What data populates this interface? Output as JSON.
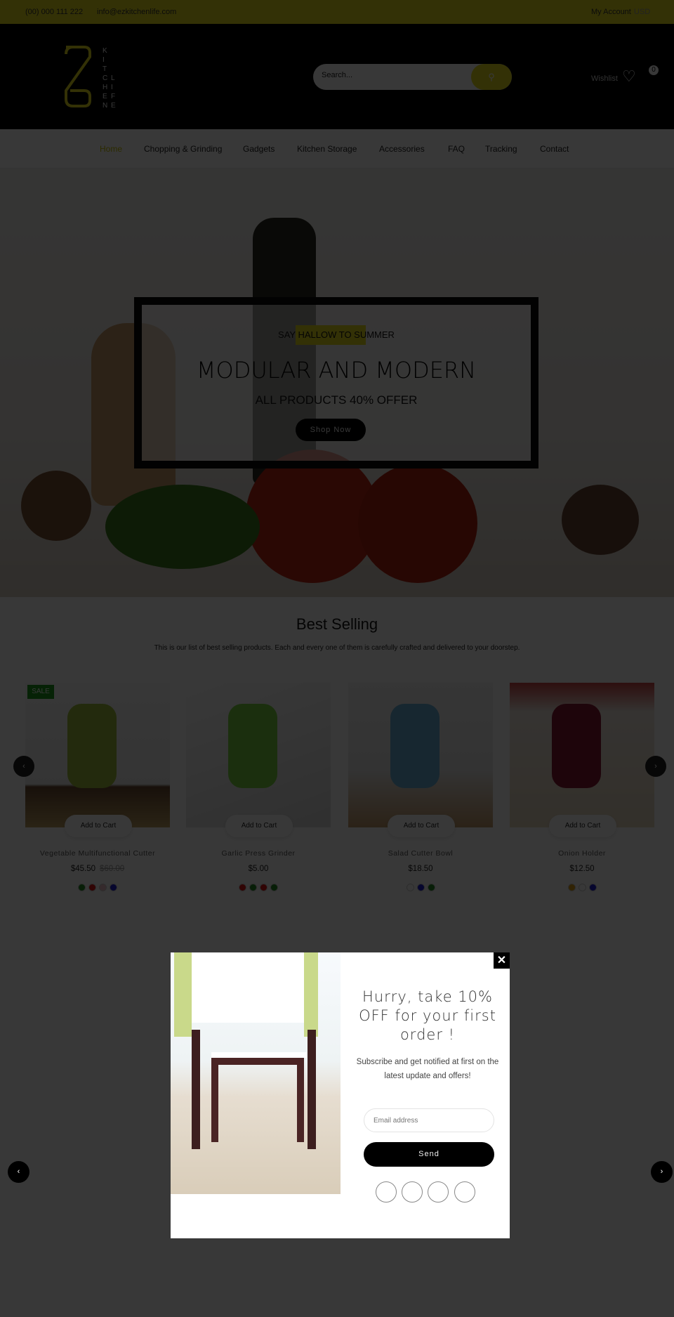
{
  "topbar": {
    "phone": "(00) 000 111 222",
    "email": "info@ezkitchenlife.com",
    "account": "My Account",
    "currency": "USD",
    "accent": "#e6e019"
  },
  "header": {
    "logo_text": "KITCHEN LIFE",
    "search_placeholder": "Search...",
    "search_icon": "search-icon",
    "wishlist": "Wishlist",
    "wishlist_count": "0"
  },
  "nav": [
    "Home",
    "Chopping & Grinding",
    "Gadgets",
    "Kitchen Storage",
    "Accessories",
    "FAQ",
    "Tracking",
    "Contact"
  ],
  "hero": {
    "kicker": "SAY HALLOW TO SUMMER",
    "title": "MODULAR AND MODERN",
    "subtitle": "ALL PRODUCTS 40% OFFER",
    "cta": "Shop Now"
  },
  "best": {
    "title": "Best Selling",
    "subtitle": "This is our list of best selling products. Each and every one of them is carefully crafted and delivered to your doorstep.",
    "products": [
      {
        "name": "Vegetable Multifunctional Cutter",
        "price": "$45.50",
        "old_price": "$60.00",
        "badge": "SALE",
        "add": "Add to Cart",
        "colors": [
          "#1f8a1f",
          "#d11",
          "#f0c0c8",
          "#1a1ad0"
        ]
      },
      {
        "name": "Garlic Press Grinder",
        "price": "$5.00",
        "add": "Add to Cart",
        "colors": [
          "#d11",
          "#1f8a1f",
          "#d11",
          "#1f8a1f"
        ]
      },
      {
        "name": "Salad Cutter Bowl",
        "price": "$18.50",
        "add": "Add to Cart",
        "colors": [
          "#ffffff",
          "#1a1ad0",
          "#1f8a1f"
        ]
      },
      {
        "name": "Onion Holder",
        "price": "$12.50",
        "add": "Add to Cart",
        "colors": [
          "#e0a010",
          "#ffffff",
          "#1a1ad0"
        ]
      }
    ]
  },
  "popup": {
    "title": "Hurry, take 10% OFF for your first order !",
    "desc": "Subscribe and get notified at first on the latest update and offers!",
    "email_placeholder": "Email address",
    "send": "Send",
    "close": "✕"
  }
}
